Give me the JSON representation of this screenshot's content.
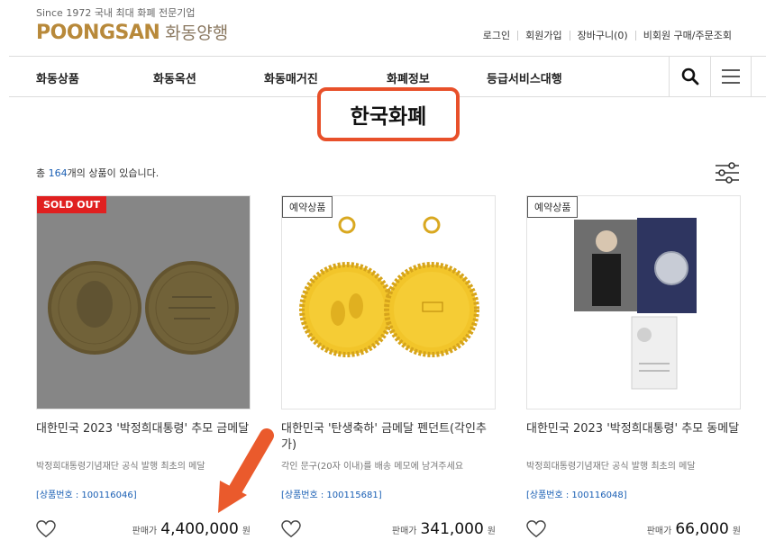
{
  "header": {
    "tagline": "Since 1972 국내 최대 화폐 전문기업",
    "logo_en": "POONGSAN",
    "logo_ko": "화동양행",
    "util_links": [
      "로그인",
      "회원가입",
      "장바구니(0)",
      "비회원 구매/주문조회"
    ]
  },
  "nav": {
    "items": [
      "화동상품",
      "화동옥션",
      "화동매거진",
      "화폐정보",
      "등급서비스대행"
    ]
  },
  "page": {
    "title": "한국화폐",
    "count_prefix": "총 ",
    "count": "164",
    "count_suffix": "개의 상품이 있습니다."
  },
  "products": [
    {
      "badge": "SOLD OUT",
      "name": "대한민국 2023 '박정희대통령' 추모 금메달",
      "desc": "박정희대통령기념재단 공식 발행 최초의 메달",
      "code": "[상품번호 : 100116046]",
      "price_label": "판매가",
      "price": "4,400,000",
      "unit": "원"
    },
    {
      "badge": "예약상품",
      "name": "대한민국 '탄생축하' 금메달 펜던트(각인추가)",
      "desc": "각인 문구(20자 이내)를 배송 메모에 남겨주세요",
      "code": "[상품번호 : 100115681]",
      "price_label": "판매가",
      "price": "341,000",
      "unit": "원"
    },
    {
      "badge": "예약상품",
      "name": "대한민국 2023 '박정희대통령' 추모 동메달",
      "desc": "박정희대통령기념재단 공식 발행 최초의 메달",
      "code": "[상품번호 : 100116048]",
      "price_label": "판매가",
      "price": "66,000",
      "unit": "원"
    }
  ],
  "colors": {
    "brand_gold": "#b8893a",
    "highlight": "#e8502a",
    "link_blue": "#1a5fb4",
    "soldout_red": "#e02020"
  }
}
